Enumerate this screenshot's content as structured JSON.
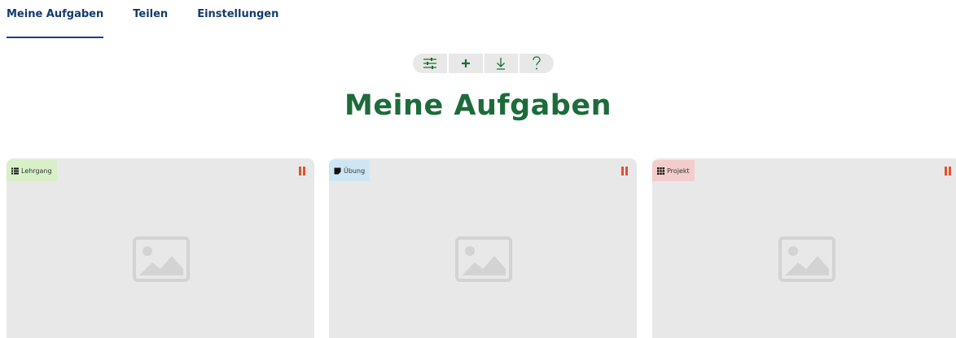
{
  "nav": {
    "tabs": [
      {
        "label": "Meine Aufgaben",
        "active": true
      },
      {
        "label": "Teilen",
        "active": false
      },
      {
        "label": "Einstellungen",
        "active": false
      }
    ]
  },
  "toolbar": {
    "buttons": [
      {
        "icon": "filter-sliders-icon",
        "label": "Filter"
      },
      {
        "icon": "plus-icon",
        "label": "+"
      },
      {
        "icon": "download-arrow-icon",
        "label": "↓"
      },
      {
        "icon": "help-icon",
        "label": "?"
      }
    ]
  },
  "page_title": "Meine Aufgaben",
  "cards": [
    {
      "tag": "Lehrgang",
      "tag_icon": "list-icon",
      "tag_color": "#d7f0c8"
    },
    {
      "tag": "Übung",
      "tag_icon": "note-icon",
      "tag_color": "#cde6f4"
    },
    {
      "tag": "Projekt",
      "tag_icon": "grid-icon",
      "tag_color": "#f4cccc"
    }
  ],
  "colors": {
    "nav_text": "#123a6e",
    "accent_green": "#1d6b3a",
    "pause_orange": "#e0522f",
    "card_bg": "#e8e8e8"
  }
}
